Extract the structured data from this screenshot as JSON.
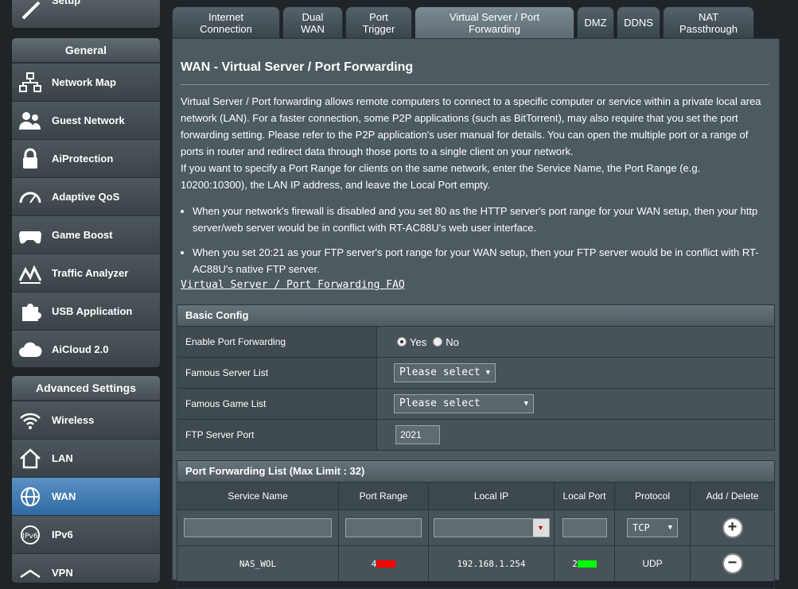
{
  "sidebar": {
    "quick_label": "Setup",
    "general_title": "General",
    "general_items": [
      {
        "label": "Network Map",
        "icon": "network-map-icon"
      },
      {
        "label": "Guest Network",
        "icon": "guest-network-icon"
      },
      {
        "label": "AiProtection",
        "icon": "lock-icon"
      },
      {
        "label": "Adaptive QoS",
        "icon": "speedometer-icon"
      },
      {
        "label": "Game Boost",
        "icon": "gamepad-icon"
      },
      {
        "label": "Traffic Analyzer",
        "icon": "traffic-chart-icon"
      },
      {
        "label": "USB Application",
        "icon": "puzzle-icon"
      },
      {
        "label": "AiCloud 2.0",
        "icon": "cloud-icon"
      }
    ],
    "advanced_title": "Advanced Settings",
    "advanced_items": [
      {
        "label": "Wireless",
        "icon": "wifi-icon"
      },
      {
        "label": "LAN",
        "icon": "home-icon"
      },
      {
        "label": "WAN",
        "icon": "globe-icon"
      },
      {
        "label": "IPv6",
        "icon": "ipv6-icon"
      },
      {
        "label": "VPN",
        "icon": "vpn-icon"
      }
    ]
  },
  "tabs": [
    {
      "label": "Internet Connection"
    },
    {
      "label": "Dual WAN"
    },
    {
      "label": "Port Trigger"
    },
    {
      "label": "Virtual Server / Port Forwarding"
    },
    {
      "label": "DMZ"
    },
    {
      "label": "DDNS"
    },
    {
      "label": "NAT Passthrough"
    }
  ],
  "main": {
    "title": "WAN - Virtual Server / Port Forwarding",
    "desc1": "Virtual Server / Port forwarding allows remote computers to connect to a specific computer or service within a private local area network (LAN). For a faster connection, some P2P applications (such as BitTorrent), may also require that you set the port forwarding setting. Please refer to the P2P application's user manual for details. You can open the multiple port or a range of ports in router and redirect data through those ports to a single client on your network.",
    "desc2": "If you want to specify a Port Range for clients on the same network, enter the Service Name, the Port Range (e.g. 10200:10300), the LAN IP address, and leave the Local Port empty.",
    "bullet1": "When your network's firewall is disabled and you set 80 as the HTTP server's port range for your WAN setup, then your http server/web server would be in conflict with RT-AC88U's web user interface.",
    "bullet2": "When you set 20:21 as your FTP server's port range for your WAN setup, then your FTP server would be in conflict with RT-AC88U's native FTP server.",
    "faq_link": "Virtual Server / Port Forwarding FAQ"
  },
  "basic": {
    "title": "Basic Config",
    "enable_label": "Enable Port Forwarding",
    "yes": "Yes",
    "no": "No",
    "famous_server_label": "Famous Server List",
    "famous_server_value": "Please select",
    "famous_game_label": "Famous Game List",
    "famous_game_value": "Please select",
    "ftp_label": "FTP Server Port",
    "ftp_value": "2021"
  },
  "pf": {
    "title": "Port Forwarding List (Max Limit : 32)",
    "headers": [
      "Service Name",
      "Port Range",
      "Local IP",
      "Local Port",
      "Protocol",
      "Add / Delete"
    ],
    "new_protocol": "TCP",
    "rows": [
      {
        "service": "NAS_WOL",
        "port_range": "4",
        "local_ip": "192.168.1.254",
        "local_port": "2",
        "protocol": "UDP"
      }
    ]
  }
}
